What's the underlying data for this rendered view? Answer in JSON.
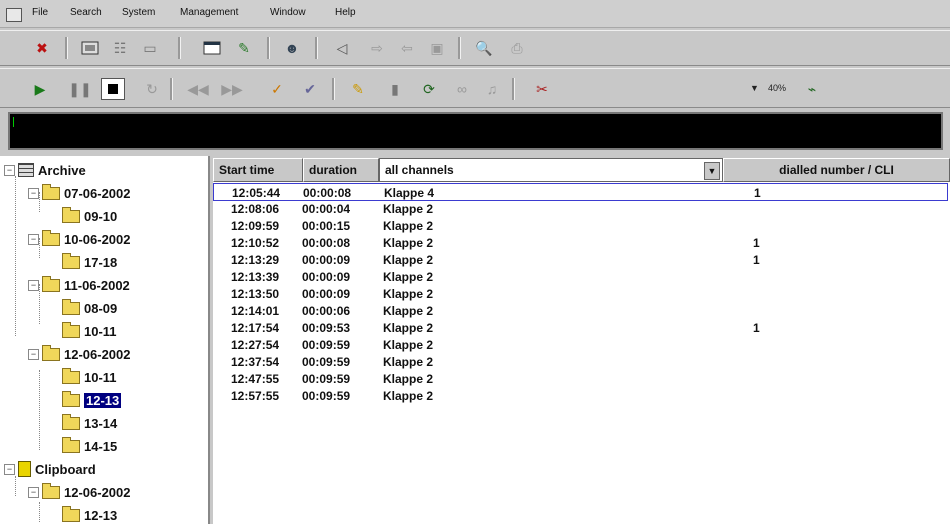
{
  "menu": [
    "File",
    "Search",
    "System",
    "Management",
    "Window",
    "Help"
  ],
  "toolbar2": {
    "zoom": "40%"
  },
  "tree": {
    "archive": {
      "label": "Archive",
      "dates": [
        {
          "label": "07-06-2002",
          "hours": [
            "09-10"
          ]
        },
        {
          "label": "10-06-2002",
          "hours": [
            "17-18"
          ]
        },
        {
          "label": "11-06-2002",
          "hours": [
            "08-09",
            "10-11"
          ]
        },
        {
          "label": "12-06-2002",
          "hours": [
            "10-11",
            "12-13",
            "13-14",
            "14-15"
          ]
        }
      ]
    },
    "clipboard": {
      "label": "Clipboard",
      "dates": [
        {
          "label": "12-06-2002",
          "hours": [
            "12-13"
          ]
        }
      ]
    },
    "selected": "12-13"
  },
  "list": {
    "headers": {
      "start": "Start time",
      "duration": "duration",
      "channel": "all channels",
      "number": "dialled number / CLI"
    },
    "rows": [
      {
        "start": "12:05:44",
        "duration": "00:00:08",
        "channel": "Klappe 4",
        "number": "1"
      },
      {
        "start": "12:08:06",
        "duration": "00:00:04",
        "channel": "Klappe 2",
        "number": ""
      },
      {
        "start": "12:09:59",
        "duration": "00:00:15",
        "channel": "Klappe 2",
        "number": ""
      },
      {
        "start": "12:10:52",
        "duration": "00:00:08",
        "channel": "Klappe 2",
        "number": "1"
      },
      {
        "start": "12:13:29",
        "duration": "00:00:09",
        "channel": "Klappe 2",
        "number": "1"
      },
      {
        "start": "12:13:39",
        "duration": "00:00:09",
        "channel": "Klappe 2",
        "number": ""
      },
      {
        "start": "12:13:50",
        "duration": "00:00:09",
        "channel": "Klappe 2",
        "number": ""
      },
      {
        "start": "12:14:01",
        "duration": "00:00:06",
        "channel": "Klappe 2",
        "number": ""
      },
      {
        "start": "12:17:54",
        "duration": "00:09:53",
        "channel": "Klappe 2",
        "number": "1"
      },
      {
        "start": "12:27:54",
        "duration": "00:09:59",
        "channel": "Klappe 2",
        "number": ""
      },
      {
        "start": "12:37:54",
        "duration": "00:09:59",
        "channel": "Klappe 2",
        "number": ""
      },
      {
        "start": "12:47:55",
        "duration": "00:09:59",
        "channel": "Klappe 2",
        "number": ""
      },
      {
        "start": "12:57:55",
        "duration": "00:09:59",
        "channel": "Klappe 2",
        "number": ""
      }
    ]
  }
}
